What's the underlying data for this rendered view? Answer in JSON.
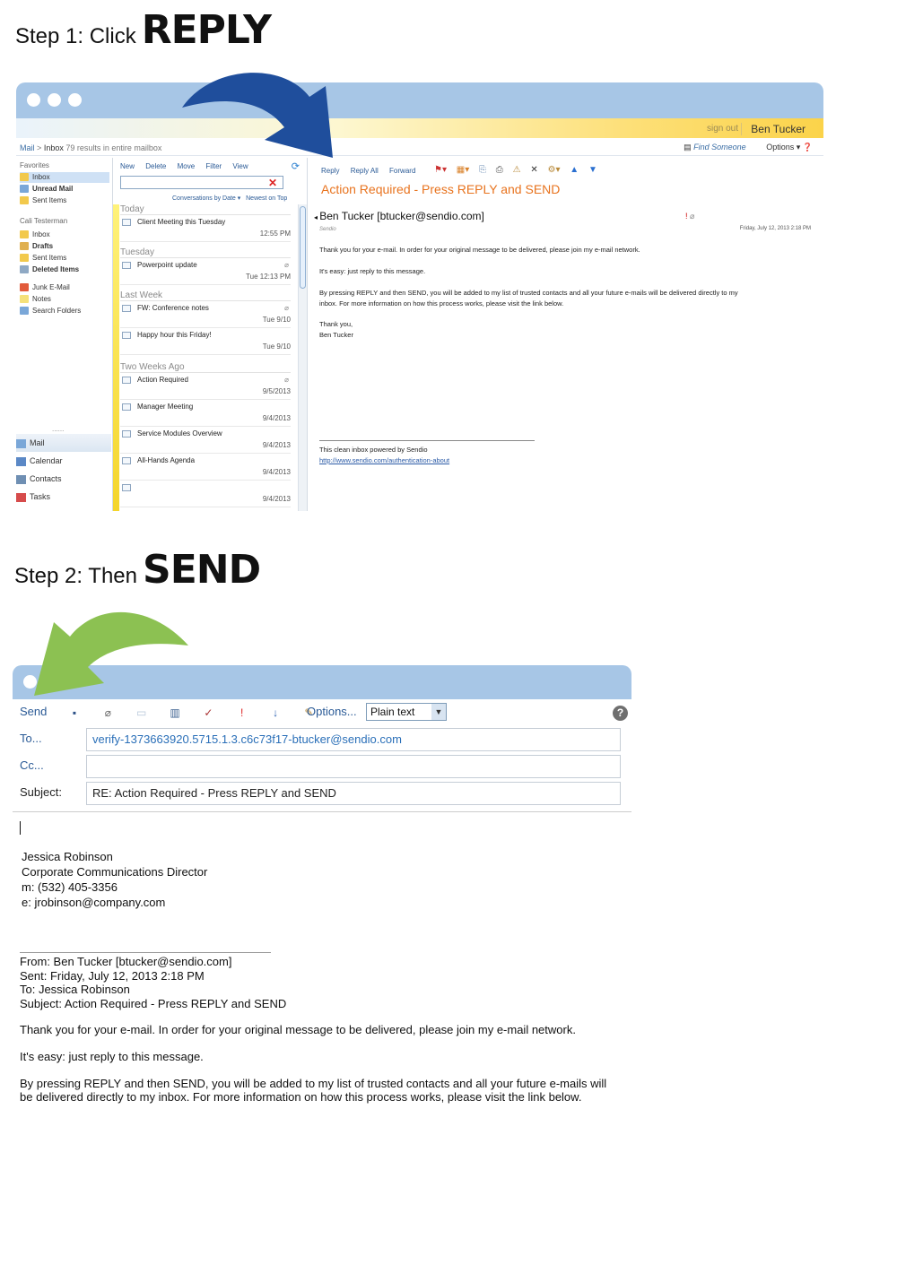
{
  "step1": {
    "prefix": "Step 1: Click",
    "action": "REPLY"
  },
  "step2": {
    "prefix": "Step 2: Then",
    "action": "SEND"
  },
  "colors": {
    "arrow1": "#1f4e9c",
    "arrow2": "#8cc152",
    "titlebar": "#a7c6e6",
    "subject_orange": "#e8731e"
  },
  "mailbox": {
    "signout": "sign out",
    "username": "Ben Tucker",
    "breadcrumb_mail": "Mail",
    "breadcrumb_sep": ">",
    "breadcrumb_inbox": "Inbox",
    "results": "79 results in entire mailbox",
    "find_someone": "Find Someone",
    "options": "Options",
    "sidebar": {
      "favorites": "Favorites",
      "fav_items": [
        "Inbox",
        "Unread Mail",
        "Sent Items"
      ],
      "account": "Cali Testerman",
      "folders": [
        "Inbox",
        "Drafts",
        "Sent Items",
        "Deleted Items",
        "Junk E-Mail",
        "Notes",
        "Search Folders"
      ],
      "dots": "......",
      "bottom": [
        "Mail",
        "Calendar",
        "Contacts",
        "Tasks"
      ]
    },
    "list": {
      "menu": [
        "New",
        "Delete",
        "Move",
        "Filter",
        "View"
      ],
      "sort_by": "Conversations by Date",
      "sort_order": "Newest on Top",
      "groups": [
        "Today",
        "Tuesday",
        "Last Week",
        "Two Weeks Ago"
      ],
      "messages": [
        {
          "subject": "Client Meeting this Tuesday",
          "date": "12:55 PM"
        },
        {
          "subject": "Powerpoint update",
          "date": "Tue 12:13 PM"
        },
        {
          "subject": "FW: Conference notes",
          "date": "Tue 9/10"
        },
        {
          "subject": "Happy hour this Friday!",
          "date": "Tue 9/10"
        },
        {
          "subject": "Action Required",
          "date": "9/5/2013"
        },
        {
          "subject": "Manager Meeting",
          "date": "9/4/2013"
        },
        {
          "subject": "Service Modules Overview",
          "date": "9/4/2013"
        },
        {
          "subject": "All-Hands Agenda",
          "date": "9/4/2013"
        },
        {
          "subject": "",
          "date": "9/4/2013"
        }
      ]
    },
    "reading": {
      "actions": [
        "Reply",
        "Reply All",
        "Forward"
      ],
      "subject": "Action Required - Press REPLY and SEND",
      "sender": "Ben Tucker [btucker@sendio.com]",
      "sender_sub": "Sendio",
      "date": "Friday, July 12, 2013 2:18 PM",
      "body": [
        "Thank you for your e-mail. In order for your original message to be delivered, please join my e-mail network.",
        "It's easy: just reply to this message.",
        "By pressing REPLY and then SEND, you will be added to my list of trusted contacts and all your future e-mails will be delivered directly to my",
        "inbox. For more information on how this process works, please visit the link below.",
        "Thank you,",
        "Ben Tucker"
      ],
      "footer": "This clean inbox powered by Sendio",
      "link": "http://www.sendio.com/authentication-about"
    }
  },
  "compose": {
    "send": "Send",
    "options": "Options...",
    "format": "Plain text",
    "to_label": "To...",
    "to_value": "verify-1373663920.5715.1.3.c6c73f17-btucker@sendio.com",
    "cc_label": "Cc...",
    "cc_value": "",
    "subject_label": "Subject:",
    "subject_value": "RE: Action Required - Press REPLY and SEND",
    "signature": [
      "Jessica Robinson",
      "Corporate Communications Director",
      "m: (532) 405-3356",
      "e: jrobinson@company.com"
    ],
    "quote_header": [
      "From: Ben Tucker [btucker@sendio.com]",
      "Sent: Friday, July 12, 2013 2:18 PM",
      "To: Jessica Robinson",
      "Subject: Action Required - Press REPLY and SEND"
    ],
    "quote_body": [
      "Thank you for your e-mail. In order for your original message to be delivered, please join my e-mail network.",
      "It's easy: just reply to this message.",
      "By pressing REPLY and then SEND, you will be added to my list of trusted contacts and all your future e-mails will",
      "be delivered directly to my inbox. For more information on how this process works, please visit the link below."
    ]
  }
}
